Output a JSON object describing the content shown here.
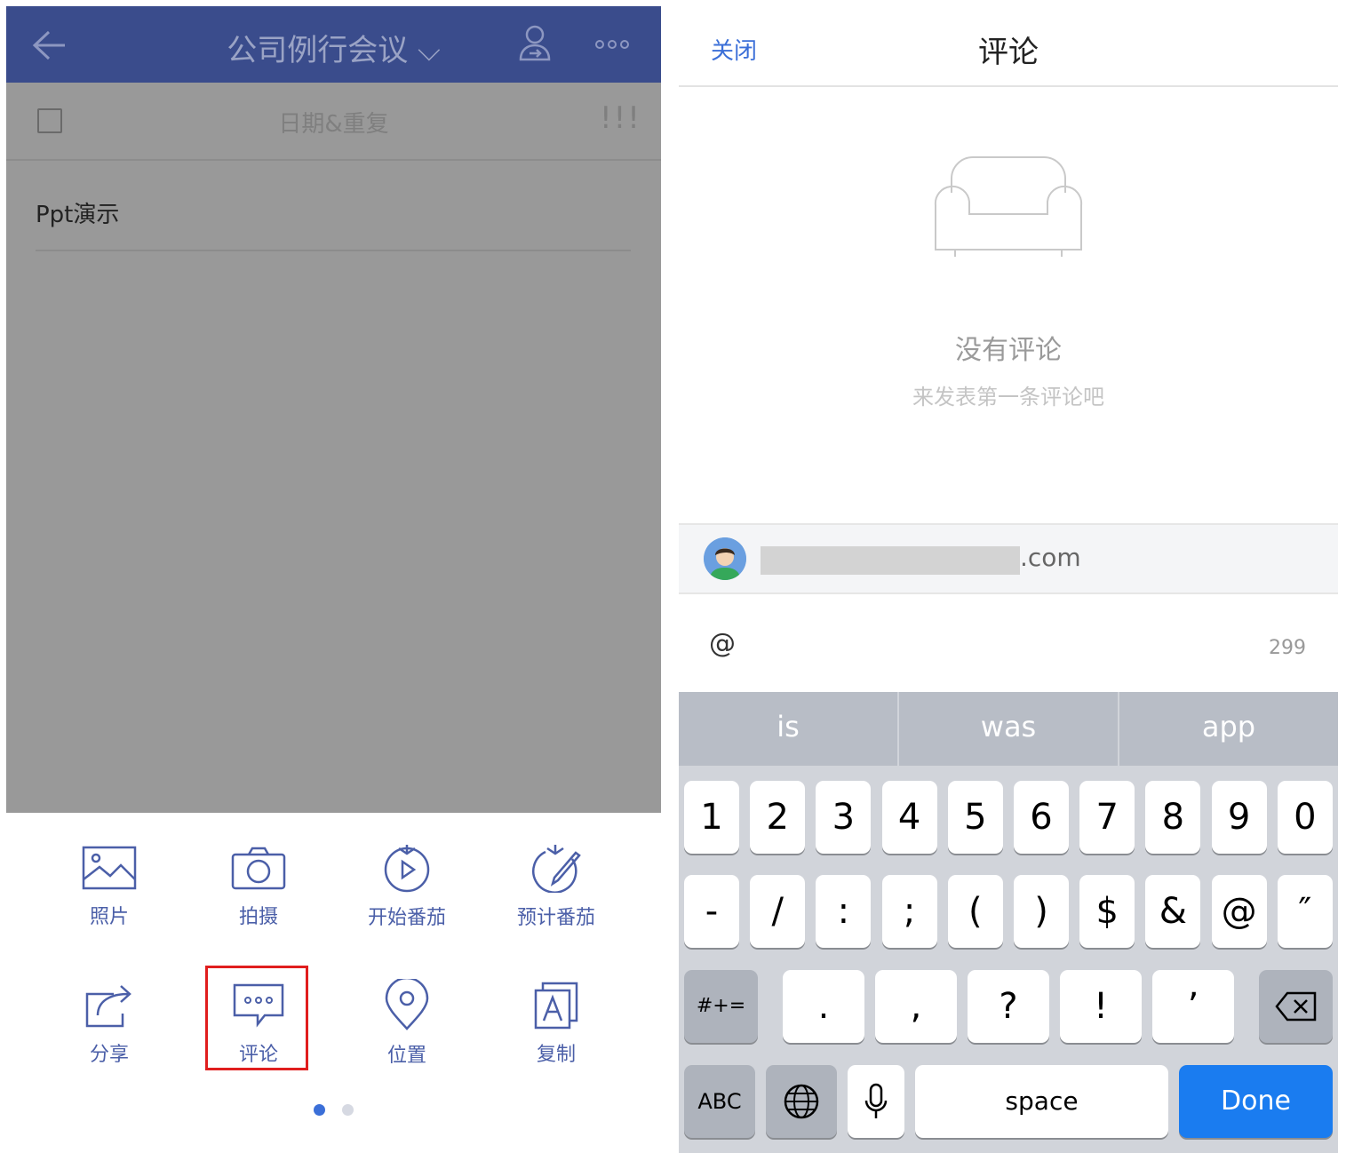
{
  "left": {
    "header": {
      "title": "公司例行会议 ⌵"
    },
    "task": {
      "date_label": "日期&重复",
      "priority": "!!!",
      "content": "Ppt演示"
    },
    "tools": [
      {
        "name": "photo",
        "label": "照片"
      },
      {
        "name": "camera",
        "label": "拍摄"
      },
      {
        "name": "start-pomodoro",
        "label": "开始番茄"
      },
      {
        "name": "plan-pomodoro",
        "label": "预计番茄"
      },
      {
        "name": "share",
        "label": "分享"
      },
      {
        "name": "comment",
        "label": "评论"
      },
      {
        "name": "location",
        "label": "位置"
      },
      {
        "name": "copy",
        "label": "复制"
      }
    ],
    "highlighted_tool": "comment",
    "page_indicator": {
      "count": 2,
      "active": 1
    },
    "colors": {
      "header": "#3a4c8c",
      "accent": "#4b5fa8",
      "highlight": "#e01e1e"
    }
  },
  "right": {
    "header": {
      "close": "关闭",
      "title": "评论"
    },
    "empty": {
      "title": "没有评论",
      "subtitle": "来发表第一条评论吧"
    },
    "user": {
      "email_suffix": ".com"
    },
    "input": {
      "value": "@",
      "remaining": "299"
    },
    "keyboard": {
      "suggestions": [
        "is",
        "was",
        "app"
      ],
      "row1": [
        "1",
        "2",
        "3",
        "4",
        "5",
        "6",
        "7",
        "8",
        "9",
        "0"
      ],
      "row2": [
        "-",
        "/",
        ":",
        ";",
        "(",
        ")",
        "$",
        "&",
        "@",
        "″"
      ],
      "row3": {
        "switch": "#+=",
        "keys": [
          ".",
          ",",
          "?",
          "!",
          "’"
        ]
      },
      "row4": {
        "abc": "ABC",
        "space": "space",
        "done": "Done"
      },
      "colors": {
        "done": "#1a7cf0"
      }
    }
  }
}
